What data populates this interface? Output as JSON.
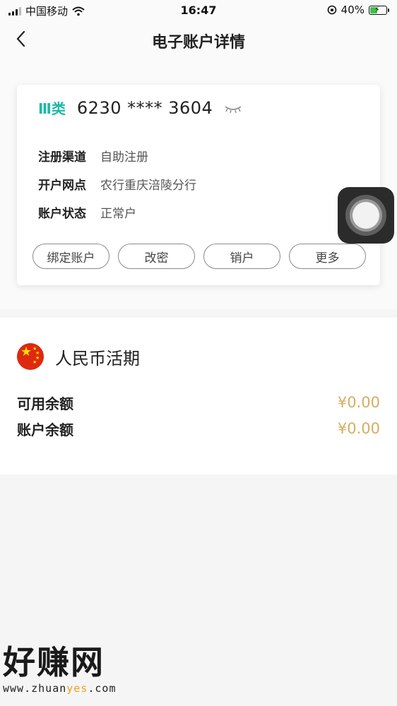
{
  "status_bar": {
    "carrier": "中国移动",
    "time": "16:47",
    "battery_percent": "40%"
  },
  "nav": {
    "back_icon": "chevron-left-icon",
    "title": "电子账户详情"
  },
  "account": {
    "type_label": "Ⅲ类",
    "number": "6230 **** 3604",
    "visibility_icon": "eye-closed-icon",
    "rows": [
      {
        "label": "注册渠道",
        "value": "自助注册"
      },
      {
        "label": "开户网点",
        "value": "农行重庆涪陵分行"
      },
      {
        "label": "账户状态",
        "value": "正常户"
      }
    ],
    "actions": [
      "绑定账户",
      "改密",
      "销户",
      "更多"
    ]
  },
  "currency": {
    "name": "人民币活期",
    "available_label": "可用余额",
    "available_value": "¥0.00",
    "balance_label": "账户余额",
    "balance_value": "¥0.00"
  },
  "watermark": {
    "title": "好赚网",
    "url_pre": "www.zhuan",
    "url_hl": "yes",
    "url_post": ".com"
  },
  "colors": {
    "accent_teal": "#1fb8a8",
    "amount_gold": "#d7ad62",
    "flag_red": "#de2910"
  }
}
